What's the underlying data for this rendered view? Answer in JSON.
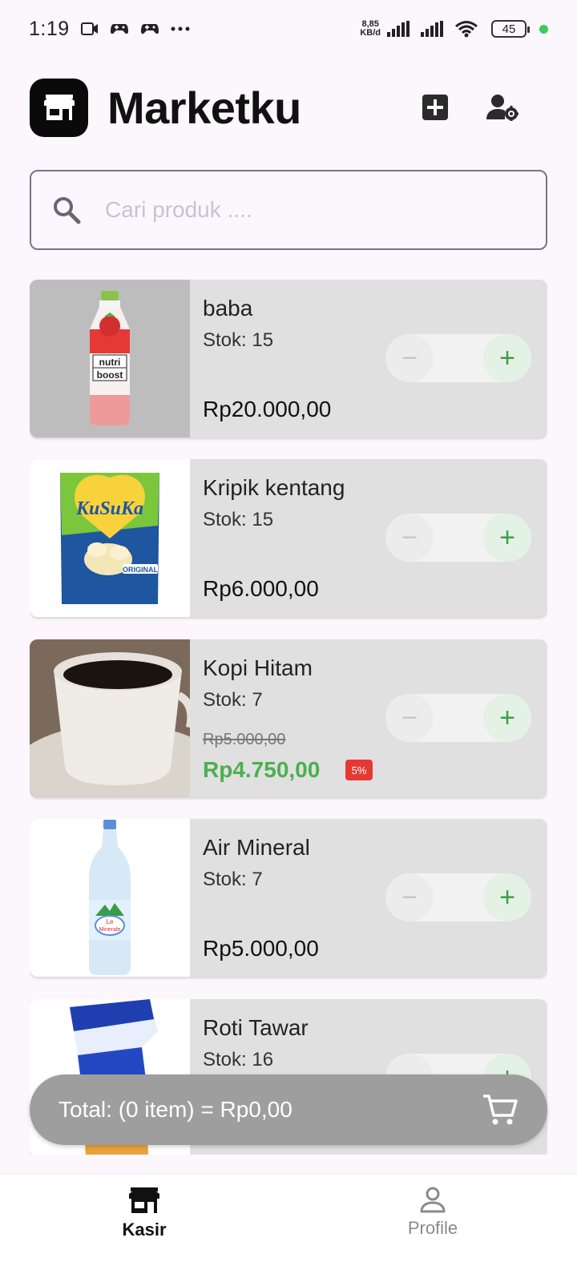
{
  "status_bar": {
    "time": "1:19",
    "speed": "8,85",
    "speed_unit": "KB/d",
    "battery": "45",
    "icons": [
      "video-icon",
      "game-controller-icon",
      "game-controller-icon",
      "more-icon",
      "signal-icon",
      "signal-icon",
      "wifi-icon",
      "battery-icon"
    ]
  },
  "header": {
    "title": "Marketku",
    "logo_icon": "storefront-icon",
    "add_icon": "add-box-icon",
    "admin_icon": "user-settings-icon"
  },
  "search": {
    "placeholder": "Cari produk ....",
    "value": ""
  },
  "products": [
    {
      "name": "baba",
      "stock": "Stok: 15",
      "price": "Rp20.000,00",
      "image": "nutriboost-bottle",
      "quantity": 0
    },
    {
      "name": "Kripik kentang",
      "stock": "Stok: 15",
      "price": "Rp6.000,00",
      "image": "kusuka-chips",
      "quantity": 0
    },
    {
      "name": "Kopi Hitam",
      "stock": "Stok: 7",
      "old_price": "Rp5.000,00",
      "price": "Rp4.750,00",
      "discount": "5%",
      "image": "coffee-cup",
      "quantity": 0
    },
    {
      "name": "Air Mineral",
      "stock": "Stok: 7",
      "price": "Rp5.000,00",
      "image": "le-minerale-bottle",
      "quantity": 0
    },
    {
      "name": "Roti Tawar",
      "stock": "Stok: 16",
      "price": "",
      "image": "bread-pack",
      "quantity": 0
    }
  ],
  "stepper": {
    "minus": "−",
    "plus": "+"
  },
  "total_bar": {
    "text": "Total: (0 item) = Rp0,00",
    "icon": "cart-icon"
  },
  "bottom_nav": [
    {
      "label": "Kasir",
      "icon": "storefront-icon",
      "active": true
    },
    {
      "label": "Profile",
      "icon": "person-icon",
      "active": false
    }
  ],
  "colors": {
    "background": "#fcf6fd",
    "card": "#e0e0e0",
    "discount_price": "#4caf50",
    "discount_badge": "#e53935",
    "plus_accent": "#3f9e45",
    "total_bar": "#9e9e9e"
  }
}
